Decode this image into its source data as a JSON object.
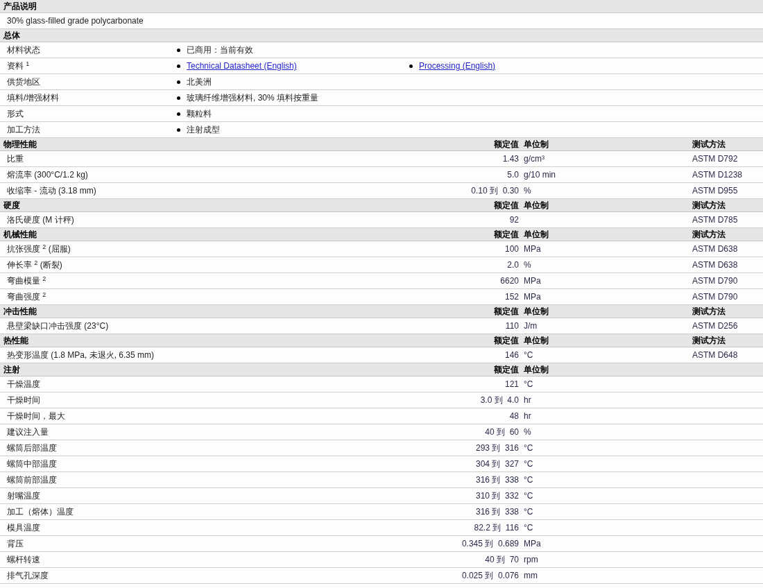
{
  "sections": [
    {
      "kind": "description",
      "title": "产品说明",
      "text": "30% glass-filled grade polycarbonate"
    },
    {
      "kind": "general",
      "title": "总体",
      "rows": [
        {
          "label": "材料状态",
          "items": [
            {
              "text": "已商用：当前有效",
              "link": false
            }
          ]
        },
        {
          "label": "资料 $^{1}$",
          "items": [
            {
              "text": "Technical Datasheet (English)",
              "link": true
            },
            {
              "text": "Processing (English)",
              "link": true
            }
          ]
        },
        {
          "label": "供货地区",
          "items": [
            {
              "text": "北美洲",
              "link": false
            }
          ]
        },
        {
          "label": "填料/增强材料",
          "items": [
            {
              "text": "玻璃纤维增强材料, 30% 填料按重量",
              "link": false
            }
          ]
        },
        {
          "label": "形式",
          "items": [
            {
              "text": "颗粒料",
              "link": false
            }
          ]
        },
        {
          "label": "加工方法",
          "items": [
            {
              "text": "注射成型",
              "link": false
            }
          ]
        }
      ]
    },
    {
      "kind": "properties",
      "title": "物理性能",
      "columns": [
        "额定值",
        "单位制",
        "测试方法"
      ],
      "rows": [
        {
          "name": "比重",
          "value": "1.43",
          "unit": "g/cm³",
          "method": "ASTM D792"
        },
        {
          "name": "熔流率  (300°C/1.2 kg)",
          "value": "5.0",
          "unit": "g/10 min",
          "method": "ASTM D1238"
        },
        {
          "name": "收缩率  - 流动  (3.18 mm)",
          "value": "0.10 到  0.30",
          "unit": "%",
          "method": "ASTM D955"
        }
      ]
    },
    {
      "kind": "properties",
      "title": "硬度",
      "columns": [
        "额定值",
        "单位制",
        "测试方法"
      ],
      "rows": [
        {
          "name": "洛氏硬度  (M 计秤)",
          "value": "92",
          "method": "ASTM D785"
        }
      ]
    },
    {
      "kind": "properties",
      "title": "机械性能",
      "columns": [
        "额定值",
        "单位制",
        "测试方法"
      ],
      "rows": [
        {
          "name": "抗张强度 $^{2}$ (屈服)",
          "value": "100",
          "unit": "MPa",
          "method": "ASTM D638"
        },
        {
          "name": "伸长率 $^{2}$ (断裂)",
          "value": "2.0",
          "unit": "%",
          "method": "ASTM D638"
        },
        {
          "name": "弯曲模量 $^{2}$",
          "value": "6620",
          "unit": "MPa",
          "method": "ASTM D790"
        },
        {
          "name": "弯曲强度 $^{2}$",
          "value": "152",
          "unit": "MPa",
          "method": "ASTM D790"
        }
      ]
    },
    {
      "kind": "properties",
      "title": "冲击性能",
      "columns": [
        "额定值",
        "单位制",
        "测试方法"
      ],
      "rows": [
        {
          "name": "悬壁梁缺口冲击强度  (23°C)",
          "value": "110",
          "unit": "J/m",
          "method": "ASTM D256"
        }
      ]
    },
    {
      "kind": "properties",
      "title": "热性能",
      "columns": [
        "额定值",
        "单位制",
        "测试方法"
      ],
      "rows": [
        {
          "name": "热变形温度  (1.8 MPa, 未退火, 6.35 mm)",
          "value": "146",
          "unit": "°C",
          "method": "ASTM D648"
        }
      ]
    },
    {
      "kind": "properties",
      "title": "注射",
      "columns": [
        "额定值",
        "单位制"
      ],
      "rows": [
        {
          "name": "干燥温度",
          "value": "121",
          "unit": "°C"
        },
        {
          "name": "干燥时间",
          "value": "3.0 到  4.0",
          "unit": "hr"
        },
        {
          "name": "干燥时间，最大",
          "value": "48",
          "unit": "hr"
        },
        {
          "name": "建议注入量",
          "value": "40 到  60",
          "unit": "%"
        },
        {
          "name": "螺筒后部温度",
          "value": "293 到  316",
          "unit": "°C"
        },
        {
          "name": "螺筒中部温度",
          "value": "304 到  327",
          "unit": "°C"
        },
        {
          "name": "螺筒前部温度",
          "value": "316 到  338",
          "unit": "°C"
        },
        {
          "name": "射嘴温度",
          "value": "310 到  332",
          "unit": "°C"
        },
        {
          "name": "加工（熔体）温度",
          "value": "316 到  338",
          "unit": "°C"
        },
        {
          "name": "模具温度",
          "value": "82.2 到  116",
          "unit": "°C"
        },
        {
          "name": "背压",
          "value": "0.345 到  0.689",
          "unit": "MPa"
        },
        {
          "name": "螺杆转速",
          "value": "40 到  70",
          "unit": "rpm"
        },
        {
          "name": "排气孔深度",
          "value": "0.025 到  0.076",
          "unit": "mm"
        }
      ]
    }
  ]
}
